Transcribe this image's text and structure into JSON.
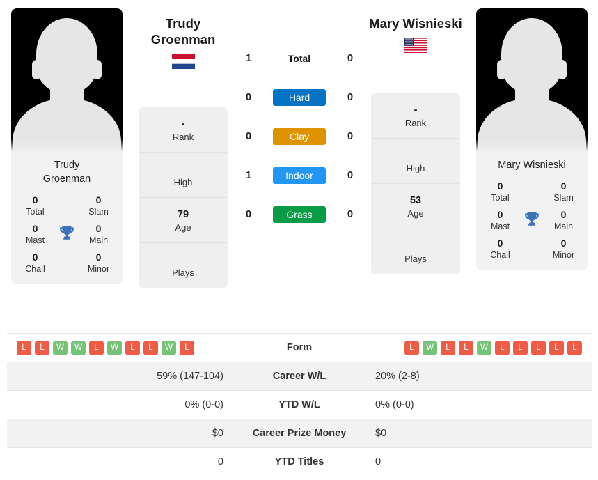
{
  "colors": {
    "win": "#74c377",
    "loss": "#ef5c45",
    "hard": "#0773c4",
    "clay": "#dd9200",
    "indoor": "#2196f3",
    "grass": "#0a9b47",
    "trophy": "#3b72b8"
  },
  "players": {
    "left": {
      "name": "Trudy Groenman",
      "name_line1": "Trudy",
      "name_line2": "Groenman",
      "card_name_line1": "Trudy",
      "card_name_line2": "Groenman",
      "flag": "netherlands-flag",
      "titles": {
        "total_value": "0",
        "total_label": "Total",
        "slam_value": "0",
        "slam_label": "Slam",
        "mast_value": "0",
        "mast_label": "Mast",
        "main_value": "0",
        "main_label": "Main",
        "chall_value": "0",
        "chall_label": "Chall",
        "minor_value": "0",
        "minor_label": "Minor"
      },
      "info": [
        {
          "value": "-",
          "label": "Rank"
        },
        {
          "value": "",
          "label": "High"
        },
        {
          "value": "79",
          "label": "Age"
        },
        {
          "value": "",
          "label": "Plays"
        }
      ],
      "surface_counts": {
        "total": "1",
        "hard": "0",
        "clay": "0",
        "indoor": "1",
        "grass": "0"
      },
      "form": [
        "L",
        "L",
        "W",
        "W",
        "L",
        "W",
        "L",
        "L",
        "W",
        "L"
      ],
      "career_wl": "59% (147-104)",
      "ytd_wl": "0% (0-0)",
      "career_prize_money": "$0",
      "ytd_titles": "0"
    },
    "right": {
      "name": "Mary Wisnieski",
      "card_name_line1": "Mary Wisnieski",
      "card_name_line2": "",
      "flag": "usa-flag",
      "titles": {
        "total_value": "0",
        "total_label": "Total",
        "slam_value": "0",
        "slam_label": "Slam",
        "mast_value": "0",
        "mast_label": "Mast",
        "main_value": "0",
        "main_label": "Main",
        "chall_value": "0",
        "chall_label": "Chall",
        "minor_value": "0",
        "minor_label": "Minor"
      },
      "info": [
        {
          "value": "-",
          "label": "Rank"
        },
        {
          "value": "",
          "label": "High"
        },
        {
          "value": "53",
          "label": "Age"
        },
        {
          "value": "",
          "label": "Plays"
        }
      ],
      "surface_counts": {
        "total": "0",
        "hard": "0",
        "clay": "0",
        "indoor": "0",
        "grass": "0"
      },
      "form": [
        "L",
        "W",
        "L",
        "L",
        "W",
        "L",
        "L",
        "L",
        "L",
        "L"
      ],
      "career_wl": "20% (2-8)",
      "ytd_wl": "0% (0-0)",
      "career_prize_money": "$0",
      "ytd_titles": "0"
    }
  },
  "surfaces": [
    {
      "key": "total",
      "label": "Total",
      "styled": false
    },
    {
      "key": "hard",
      "label": "Hard",
      "styled": true
    },
    {
      "key": "clay",
      "label": "Clay",
      "styled": true
    },
    {
      "key": "indoor",
      "label": "Indoor",
      "styled": true
    },
    {
      "key": "grass",
      "label": "Grass",
      "styled": true
    }
  ],
  "table": {
    "rows": [
      {
        "label": "Form",
        "key": "form"
      },
      {
        "label": "Career W/L",
        "key": "career_wl"
      },
      {
        "label": "YTD W/L",
        "key": "ytd_wl"
      },
      {
        "label": "Career Prize Money",
        "key": "career_prize_money"
      },
      {
        "label": "YTD Titles",
        "key": "ytd_titles"
      }
    ]
  }
}
